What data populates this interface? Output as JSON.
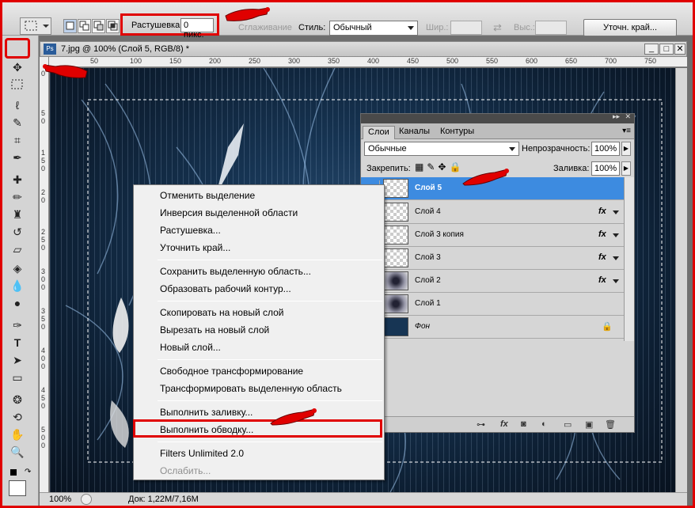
{
  "options_bar": {
    "feather_label": "Растушевка:",
    "feather_value": "0 пикс.",
    "antialias_label": "Сглаживание",
    "style_label": "Стиль:",
    "style_value": "Обычный",
    "width_label": "Шир.:",
    "height_label": "Выс.:",
    "refine_button": "Уточн. край..."
  },
  "document": {
    "title": "7.jpg @ 100% (Слой 5, RGB/8) *",
    "ruler_top": [
      "50",
      "100",
      "150",
      "200",
      "250",
      "300",
      "350",
      "400",
      "450",
      "500",
      "550",
      "600",
      "650",
      "700",
      "750"
    ],
    "ruler_left": [
      "0",
      "5",
      "0",
      "1",
      "5",
      "0",
      "2",
      "0",
      "2",
      "5",
      "0",
      "3",
      "0",
      "0",
      "3",
      "5",
      "0",
      "4",
      "0",
      "0",
      "4",
      "5",
      "0",
      "5",
      "0",
      "0"
    ],
    "zoom": "100%",
    "doc_info": "Док: 1,22M/7,16M"
  },
  "layers_panel": {
    "tabs": [
      "Слои",
      "Каналы",
      "Контуры"
    ],
    "blend_mode": "Обычные",
    "opacity_label": "Непрозрачность:",
    "opacity_value": "100%",
    "lock_label": "Закрепить:",
    "fill_label": "Заливка:",
    "fill_value": "100%",
    "layers": [
      {
        "name": "Слой 5",
        "selected": true,
        "fx": false
      },
      {
        "name": "Слой 4",
        "selected": false,
        "fx": true
      },
      {
        "name": "Слой 3 копия",
        "selected": false,
        "fx": true
      },
      {
        "name": "Слой 3",
        "selected": false,
        "fx": true
      },
      {
        "name": "Слой 2",
        "selected": false,
        "fx": true
      },
      {
        "name": "Слой 1",
        "selected": false,
        "fx": false
      },
      {
        "name": "Фон",
        "selected": false,
        "fx": false,
        "locked": true
      }
    ],
    "fx_label": "fx"
  },
  "context_menu": {
    "items": [
      "Отменить выделение",
      "Инверсия выделенной области",
      "Растушевка...",
      "Уточнить край...",
      "Сохранить выделенную область...",
      "Образовать рабочий контур...",
      "Скопировать на новый слой",
      "Вырезать на новый слой",
      "Новый слой...",
      "Свободное трансформирование",
      "Трансформировать выделенную область",
      "Выполнить заливку...",
      "Выполнить обводку...",
      "Filters Unlimited 2.0",
      "Ослабить..."
    ]
  },
  "colors": {
    "highlight_red": "#e00000",
    "selection_blue": "#3d8be0",
    "canvas_dark_blue": "#173554"
  }
}
